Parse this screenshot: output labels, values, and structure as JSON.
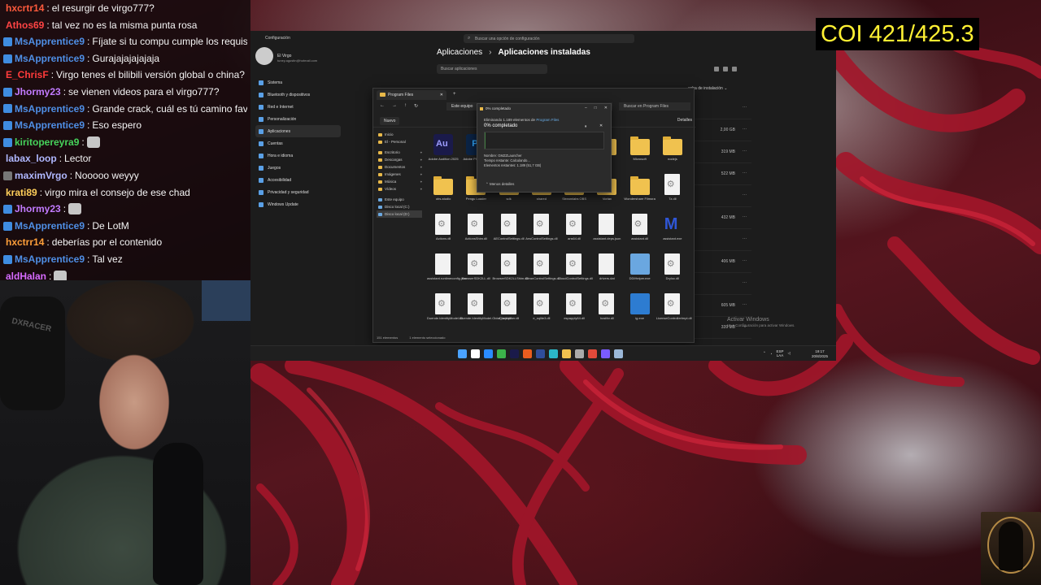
{
  "chat": [
    {
      "user": "hxcrtr14",
      "color": "#ff5a3c",
      "badge": "none",
      "text": "el resurgir de virgo777?"
    },
    {
      "user": "Athos69",
      "color": "#ff4444",
      "badge": "none",
      "text": "tal vez no es la misma punta rosa"
    },
    {
      "user": "MsApprentice9",
      "color": "#4f8fe6",
      "badge": "mod",
      "text": "Fíjate si tu compu cumple los requisitos"
    },
    {
      "user": "MsApprentice9",
      "color": "#4f8fe6",
      "badge": "mod",
      "text": "Gurajajajajajaja"
    },
    {
      "user": "E_ChrisF",
      "color": "#ff3b3b",
      "badge": "none",
      "text": "Virgo tenes el bilibili versión global o china?"
    },
    {
      "user": "Jhormy23",
      "color": "#c27bff",
      "badge": "mod",
      "text": "se vienen videos para el virgo777?"
    },
    {
      "user": "MsApprentice9",
      "color": "#4f8fe6",
      "badge": "mod",
      "text": "Grande crack, cuál es tú camino favorito"
    },
    {
      "user": "MsApprentice9",
      "color": "#4f8fe6",
      "badge": "mod",
      "text": "Eso espero"
    },
    {
      "user": "kiritopereyra9",
      "color": "#46d35b",
      "badge": "mod",
      "text": "",
      "emote": true
    },
    {
      "user": "labax_loop",
      "color": "#b0b8ff",
      "badge": "none",
      "text": "Lector"
    },
    {
      "user": "maximVrgo",
      "color": "#b0b8ff",
      "badge": "gray",
      "text": "Nooooo weyyy"
    },
    {
      "user": "krati89",
      "color": "#ffcf5a",
      "badge": "none",
      "text": "virgo mira el consejo de ese chad"
    },
    {
      "user": "Jhormy23",
      "color": "#c27bff",
      "badge": "mod",
      "text": "",
      "emote": true
    },
    {
      "user": "MsApprentice9",
      "color": "#4f8fe6",
      "badge": "mod",
      "text": "De LotM"
    },
    {
      "user": "hxctrr14",
      "color": "#ff9f3a",
      "badge": "none",
      "text": "deberías por el contenido"
    },
    {
      "user": "MsApprentice9",
      "color": "#4f8fe6",
      "badge": "mod",
      "text": "Tal vez"
    },
    {
      "user": "aldHalan",
      "color": "#d86bff",
      "badge": "none",
      "text": "",
      "emote": true
    }
  ],
  "webcam": {
    "chair_brand": "DXRACER"
  },
  "settings": {
    "app_title": "Configuración",
    "search_placeholder": "Buscar una opción de configuración",
    "profile_name": "El Virgo",
    "profile_email": "tuney.agustin@hotmail.com",
    "nav": [
      {
        "label": "Sistema",
        "active": false
      },
      {
        "label": "Bluetooth y dispositivos",
        "active": false
      },
      {
        "label": "Red e Internet",
        "active": false
      },
      {
        "label": "Personalización",
        "active": false
      },
      {
        "label": "Aplicaciones",
        "active": true
      },
      {
        "label": "Cuentas",
        "active": false
      },
      {
        "label": "Hora e idioma",
        "active": false
      },
      {
        "label": "Juegos",
        "active": false
      },
      {
        "label": "Accesibilidad",
        "active": false
      },
      {
        "label": "Privacidad y seguridad",
        "active": false
      },
      {
        "label": "Windows Update",
        "active": false
      }
    ],
    "breadcrumb_parent": "Aplicaciones",
    "breadcrumb_sep": "›",
    "breadcrumb_current": "Aplicaciones instaladas",
    "apps_search_placeholder": "Buscar aplicaciones",
    "sort_label": "echa de instalación",
    "app_rows": [
      {
        "size": ""
      },
      {
        "size": "2,00 GB"
      },
      {
        "size": "319 MB"
      },
      {
        "size": "522 MB"
      },
      {
        "size": ""
      },
      {
        "size": "432 MB"
      },
      {
        "size": ""
      },
      {
        "size": "406 MB"
      },
      {
        "size": ""
      },
      {
        "size": "605 MB"
      },
      {
        "size": "339 MB"
      }
    ],
    "more_glyph": "···",
    "watermark_title": "Activar Windows",
    "watermark_sub": "Ve a Configuración para activar Windows."
  },
  "explorer": {
    "tab_title": "Program Files",
    "address": "Este equipo",
    "search_placeholder": "Buscar en Program Files",
    "new_label": "Nuevo",
    "details_label": "Detalles",
    "sidebar": [
      {
        "label": "Inicio",
        "pc": false,
        "pin": false,
        "sel": false
      },
      {
        "label": "El - Personal",
        "pc": false,
        "pin": false,
        "sel": false
      },
      {
        "gap": true
      },
      {
        "label": "Escritorio",
        "pc": false,
        "pin": true,
        "sel": false
      },
      {
        "label": "Descargas",
        "pc": false,
        "pin": true,
        "sel": false
      },
      {
        "label": "Documentos",
        "pc": false,
        "pin": true,
        "sel": false
      },
      {
        "label": "Imágenes",
        "pc": false,
        "pin": true,
        "sel": false
      },
      {
        "label": "Música",
        "pc": false,
        "pin": true,
        "sel": false
      },
      {
        "label": "Vídeos",
        "pc": false,
        "pin": true,
        "sel": false
      },
      {
        "gap": true
      },
      {
        "label": "Este equipo",
        "pc": true,
        "pin": false,
        "sel": false
      },
      {
        "label": "Disco local (C:)",
        "pc": true,
        "pin": false,
        "sel": false
      },
      {
        "label": "Disco local (D:)",
        "pc": true,
        "pin": false,
        "sel": true
      }
    ],
    "items": [
      {
        "name": "Adobe Audition 2025",
        "kind": "au"
      },
      {
        "name": "Adobe Photoshop",
        "kind": "ps"
      },
      {
        "name": "",
        "kind": "none"
      },
      {
        "name": "",
        "kind": "none"
      },
      {
        "name": "",
        "kind": "none"
      },
      {
        "name": "",
        "kind": "folder"
      },
      {
        "name": "Microsoft",
        "kind": "folder"
      },
      {
        "name": "nodejs",
        "kind": "folder"
      },
      {
        "name": "obs-studio",
        "kind": "folder"
      },
      {
        "name": "Pengu Loader",
        "kind": "folder"
      },
      {
        "name": "sdk",
        "kind": "folder"
      },
      {
        "name": "shared",
        "kind": "folder"
      },
      {
        "name": "Streamlabs OBS",
        "kind": "folder"
      },
      {
        "name": "Vorlax",
        "kind": "folder"
      },
      {
        "name": "Wondershare Filmora",
        "kind": "folder"
      },
      {
        "name": "7z.dll",
        "kind": "dll"
      },
      {
        "name": "Actions.dll",
        "kind": "dll"
      },
      {
        "name": "ActionsShim.dll",
        "kind": "dll"
      },
      {
        "name": "AEControlSettings.dll",
        "kind": "dll"
      },
      {
        "name": "ArwControlSettings.dll",
        "kind": "dll"
      },
      {
        "name": "ans64.dll",
        "kind": "dll"
      },
      {
        "name": "assistant.deps.json",
        "kind": "file"
      },
      {
        "name": "assistant.dll",
        "kind": "dll"
      },
      {
        "name": "assistant.exe",
        "kind": "mb"
      },
      {
        "name": "assistant.runtimeconfig.json",
        "kind": "file"
      },
      {
        "name": "BrowserSDK2LL.dll",
        "kind": "dll"
      },
      {
        "name": "BrowserSDK2LLShim.dll",
        "kind": "dll"
      },
      {
        "name": "CleanControlSettings.dll",
        "kind": "dll"
      },
      {
        "name": "CloudControlSettings.dll",
        "kind": "dll"
      },
      {
        "name": "drivers.dat",
        "kind": "file"
      },
      {
        "name": "DDIHelper.exe",
        "kind": "win"
      },
      {
        "name": "Dryloc.dll",
        "kind": "dll"
      },
      {
        "name": "Duende.IdentityModel.dll",
        "kind": "dll"
      },
      {
        "name": "Duende.IdentityModel.OidcClient.dll",
        "kind": "dll"
      },
      {
        "name": "e_sqlcipher.dll",
        "kind": "dll"
      },
      {
        "name": "e_sqlite3.dll",
        "kind": "dll"
      },
      {
        "name": "espapply64.dll",
        "kind": "dll"
      },
      {
        "name": "hostfxr.dll",
        "kind": "dll"
      },
      {
        "name": "ig.exe",
        "kind": "blue"
      },
      {
        "name": "LicenseControllerImpl.dll",
        "kind": "dll"
      }
    ],
    "status_count": "151 elementos",
    "status_selected": "1 elemento seleccionado"
  },
  "progress": {
    "title": "0% completado",
    "line1_prefix": "Eliminando 1.189 elementos de",
    "line1_target": "Program Files",
    "percent_text": "0% completado",
    "percent_value": 0.01,
    "pause_glyph": "⏸",
    "close_glyph": "✕",
    "name_line": "Nombre: GMZZLauncher",
    "time_line": "Tiempo restante: Calculando...",
    "items_line": "Elementos restantes: 1.189 (51,7 GB)",
    "less_details": "Menos detalles",
    "min_glyph": "–",
    "max_glyph": "□",
    "x_glyph": "✕"
  },
  "taskbar": {
    "icon_colors": [
      "#4aa3ff",
      "#ffffff",
      "#2a8cff",
      "#3cb34a",
      "#1a1a4a",
      "#e85d1f",
      "#2f4d9a",
      "#2bb8c8",
      "#f0c24f",
      "#aaaaaa",
      "#e04a3a",
      "#7a5cff",
      "#9bb8d8"
    ],
    "tray_lang": "ESP",
    "tray_region": "LAA",
    "time": "19:17",
    "date": "20/8/2025"
  },
  "overlay": {
    "coi_text": "COI 421/425.3"
  }
}
